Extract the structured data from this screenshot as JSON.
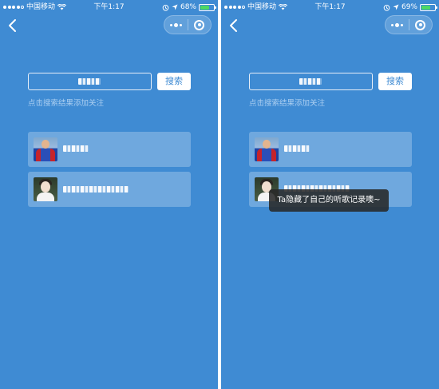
{
  "screens": [
    {
      "status": {
        "carrier": "中国移动",
        "time": "下午1:17",
        "battery": "68%",
        "battery_level": 0.68
      },
      "search_button": "搜索",
      "hint": "点击搜索结果添加关注"
    },
    {
      "status": {
        "carrier": "中国移动",
        "time": "下午1:17",
        "battery": "69%",
        "battery_level": 0.69
      },
      "search_button": "搜索",
      "hint": "点击搜索结果添加关注",
      "toast": "Ta隐藏了自己的听歌记录噢~"
    }
  ],
  "colors": {
    "background": "#3f8bd3",
    "battery_fill": "#4cd964",
    "hint": "#a9cdf0"
  },
  "icons": [
    "back-chevron-icon",
    "wifi-icon",
    "location-arrow-icon",
    "alarm-icon",
    "menu-dots-icon",
    "close-ring-icon",
    "battery-icon"
  ]
}
